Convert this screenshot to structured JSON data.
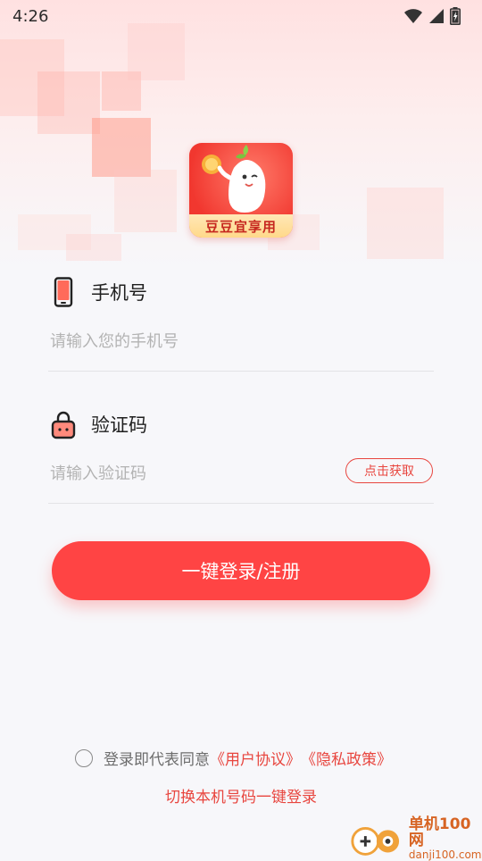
{
  "status_bar": {
    "time": "4:26"
  },
  "logo": {
    "text": "豆豆宜享用"
  },
  "phone": {
    "label": "手机号",
    "placeholder": "请输入您的手机号"
  },
  "code": {
    "label": "验证码",
    "placeholder": "请输入验证码",
    "get_code_label": "点击获取"
  },
  "login_button": {
    "label": "一键登录/注册"
  },
  "agreement": {
    "prefix": "登录即代表同意",
    "user_agreement": "《用户协议》",
    "privacy_policy": "《隐私政策》"
  },
  "switch_login": {
    "label": "切换本机号码一键登录"
  },
  "watermark": {
    "line1": "单机100网",
    "line2": "danji100.com"
  },
  "colors": {
    "accent": "#ff4444",
    "link": "#e8463f"
  }
}
